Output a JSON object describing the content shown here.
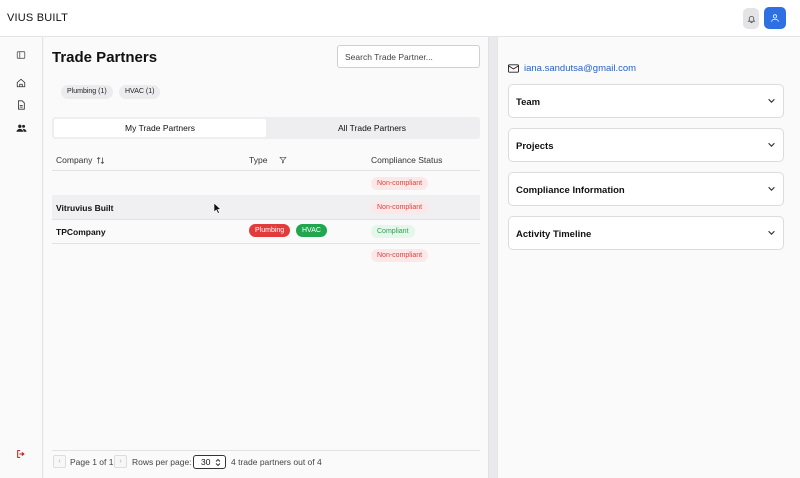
{
  "app": {
    "brand": "VIUS BUILT"
  },
  "main": {
    "title": "Trade Partners",
    "search_placeholder": "Search Trade Partner...",
    "chips": [
      "Plumbing (1)",
      "HVAC (1)"
    ],
    "tabs": [
      "My Trade Partners",
      "All Trade Partners"
    ],
    "active_tab": "My Trade Partners",
    "columns": {
      "company": "Company",
      "type": "Type",
      "compliance": "Compliance Status"
    },
    "rows": [
      {
        "company": "",
        "types": [],
        "status": "Non-compliant"
      },
      {
        "company": "Vitruvius Built",
        "types": [],
        "status": "Non-compliant"
      },
      {
        "company": "TPCompany",
        "types": [
          "Plumbing",
          "HVAC"
        ],
        "status": "Compliant"
      },
      {
        "company": "",
        "types": [],
        "status": "Non-compliant"
      }
    ],
    "footer": {
      "page": "Page 1 of 1",
      "rows_label": "Rows per page:",
      "rows_value": "30",
      "summary": "4 trade partners out of 4"
    }
  },
  "panel": {
    "email": "iana.sandutsa@gmail.com",
    "sections": [
      "Team",
      "Projects",
      "Compliance Information",
      "Activity Timeline"
    ]
  },
  "colors": {
    "accent": "#2f6fe4",
    "non_compliant": "#d94343",
    "compliant": "#2f9e4f",
    "tag_plumbing": "#e23b3b",
    "tag_hvac": "#21a650"
  },
  "icons": {
    "top": [
      "bell-icon",
      "user-icon"
    ],
    "sidebar": [
      "panel-toggle-icon",
      "home-icon",
      "document-icon",
      "users-icon",
      "logout-icon"
    ],
    "panel": [
      "mail-icon",
      "chevron-down-icon"
    ]
  }
}
